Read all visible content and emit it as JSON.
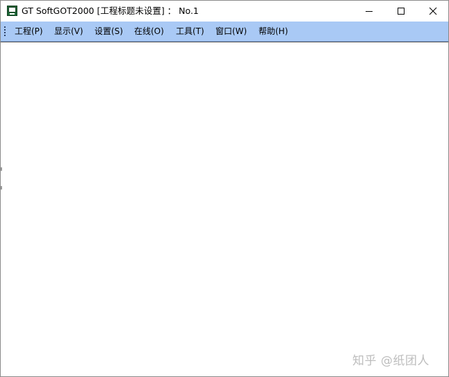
{
  "window": {
    "title": "GT SoftGOT2000  [工程标题未设置] ：  No.1",
    "controls": {
      "minimize": "minimize-icon",
      "maximize": "maximize-icon",
      "close": "close-icon"
    }
  },
  "menubar": {
    "items": [
      {
        "label": "工程(P)"
      },
      {
        "label": "显示(V)"
      },
      {
        "label": "设置(S)"
      },
      {
        "label": "在线(O)"
      },
      {
        "label": "工具(T)"
      },
      {
        "label": "窗口(W)"
      },
      {
        "label": "帮助(H)"
      }
    ]
  },
  "watermark": "知乎 @纸团人",
  "colors": {
    "menubar_bg": "#a9c9f5",
    "window_border": "#8a8a8a"
  }
}
